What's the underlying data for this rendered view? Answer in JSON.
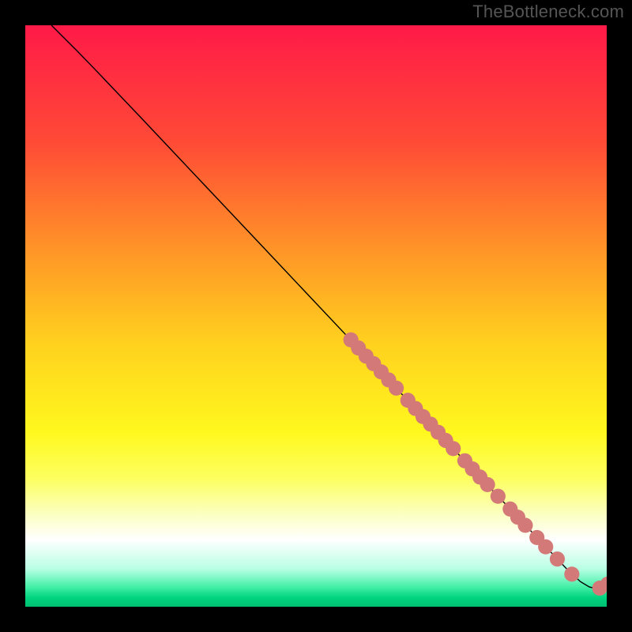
{
  "watermark": "TheBottleneck.com",
  "gradient": {
    "stops": [
      {
        "offset": 0.0,
        "color": "#ff1a48"
      },
      {
        "offset": 0.2,
        "color": "#ff4a36"
      },
      {
        "offset": 0.4,
        "color": "#ff9a26"
      },
      {
        "offset": 0.55,
        "color": "#ffd21e"
      },
      {
        "offset": 0.7,
        "color": "#fff81e"
      },
      {
        "offset": 0.78,
        "color": "#fdff60"
      },
      {
        "offset": 0.84,
        "color": "#fbffc0"
      },
      {
        "offset": 0.885,
        "color": "#ffffff"
      },
      {
        "offset": 0.935,
        "color": "#b8ffe4"
      },
      {
        "offset": 0.965,
        "color": "#47f0a8"
      },
      {
        "offset": 0.985,
        "color": "#00d37d"
      },
      {
        "offset": 1.0,
        "color": "#00c070"
      }
    ]
  },
  "chart_data": {
    "type": "line",
    "title": "",
    "xlabel": "",
    "ylabel": "",
    "xlim": [
      0,
      100
    ],
    "ylim": [
      0,
      100
    ],
    "series": [
      {
        "name": "curve",
        "points": [
          {
            "x": 4.5,
            "y": 100.0
          },
          {
            "x": 6.5,
            "y": 98.0
          },
          {
            "x": 9.0,
            "y": 95.5
          },
          {
            "x": 12.0,
            "y": 92.4
          },
          {
            "x": 20.0,
            "y": 84.0
          },
          {
            "x": 40.0,
            "y": 62.8
          },
          {
            "x": 60.0,
            "y": 41.6
          },
          {
            "x": 80.0,
            "y": 20.4
          },
          {
            "x": 90.0,
            "y": 9.8
          },
          {
            "x": 93.5,
            "y": 6.1
          },
          {
            "x": 95.5,
            "y": 4.3
          },
          {
            "x": 97.0,
            "y": 3.4
          },
          {
            "x": 98.2,
            "y": 3.1
          },
          {
            "x": 99.0,
            "y": 3.3
          },
          {
            "x": 100.0,
            "y": 3.8
          }
        ]
      }
    ],
    "markers": {
      "color": "#d37a78",
      "rx": 1.3,
      "ry": 1.3,
      "points": [
        {
          "x": 56.0,
          "y": 45.9
        },
        {
          "x": 57.3,
          "y": 44.5
        },
        {
          "x": 58.6,
          "y": 43.1
        },
        {
          "x": 59.9,
          "y": 41.8
        },
        {
          "x": 61.2,
          "y": 40.4
        },
        {
          "x": 62.5,
          "y": 39.0
        },
        {
          "x": 63.8,
          "y": 37.6
        },
        {
          "x": 65.8,
          "y": 35.5
        },
        {
          "x": 67.1,
          "y": 34.1
        },
        {
          "x": 68.4,
          "y": 32.7
        },
        {
          "x": 69.7,
          "y": 31.4
        },
        {
          "x": 71.0,
          "y": 30.0
        },
        {
          "x": 72.3,
          "y": 28.6
        },
        {
          "x": 73.6,
          "y": 27.2
        },
        {
          "x": 75.6,
          "y": 25.1
        },
        {
          "x": 76.9,
          "y": 23.7
        },
        {
          "x": 78.2,
          "y": 22.3
        },
        {
          "x": 79.5,
          "y": 21.0
        },
        {
          "x": 81.3,
          "y": 19.0
        },
        {
          "x": 83.4,
          "y": 16.8
        },
        {
          "x": 84.7,
          "y": 15.4
        },
        {
          "x": 86.0,
          "y": 14.0
        },
        {
          "x": 88.0,
          "y": 11.9
        },
        {
          "x": 89.5,
          "y": 10.3
        },
        {
          "x": 91.5,
          "y": 8.2
        },
        {
          "x": 94.0,
          "y": 5.6
        },
        {
          "x": 98.8,
          "y": 3.2
        },
        {
          "x": 100.2,
          "y": 3.9
        }
      ]
    }
  }
}
